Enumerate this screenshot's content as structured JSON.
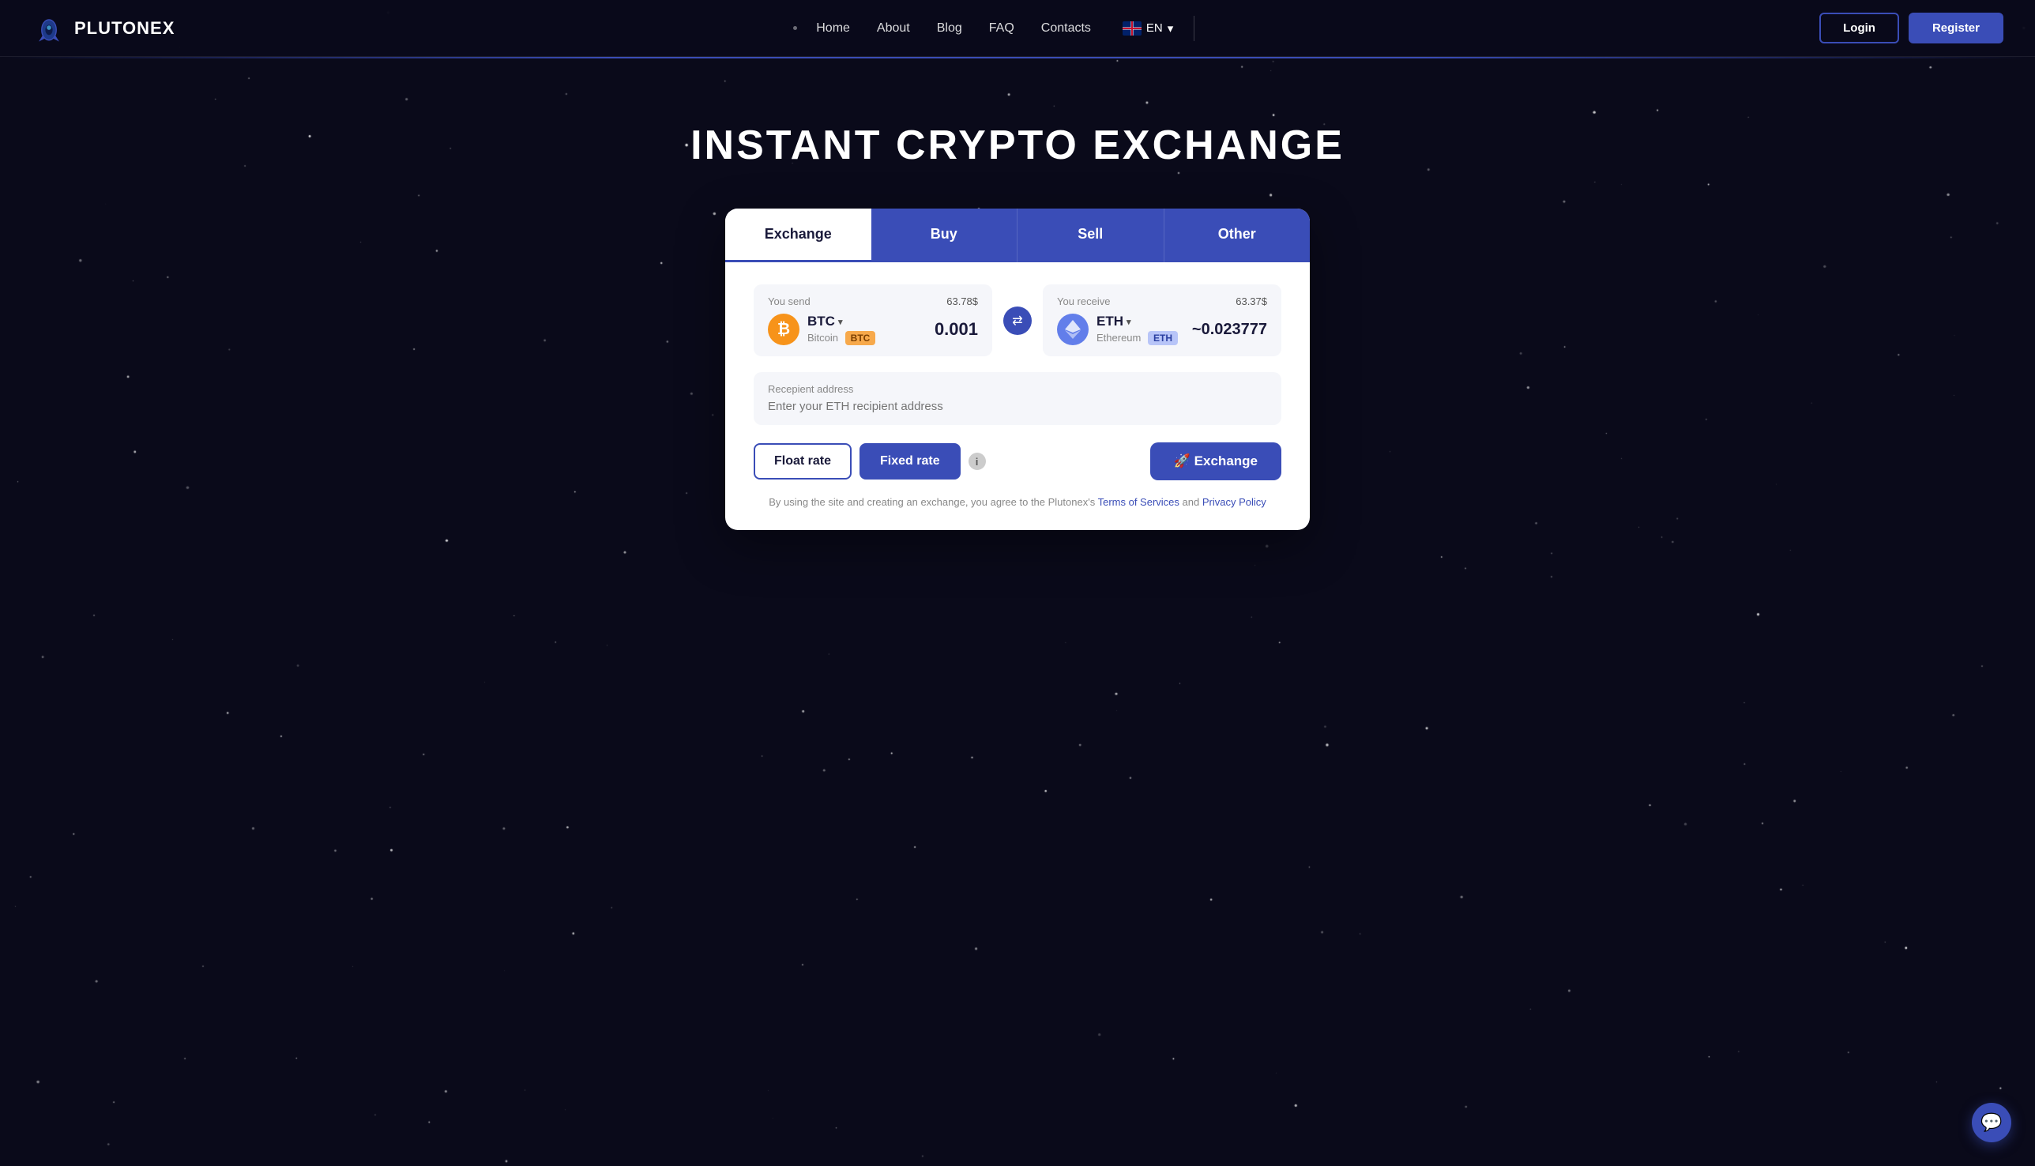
{
  "brand": {
    "name": "PLUTONEX",
    "logo_alt": "Plutonex rocket logo"
  },
  "navbar": {
    "nav_items": [
      {
        "label": "Home",
        "id": "home"
      },
      {
        "label": "About",
        "id": "about"
      },
      {
        "label": "Blog",
        "id": "blog"
      },
      {
        "label": "FAQ",
        "id": "faq"
      },
      {
        "label": "Contacts",
        "id": "contacts"
      }
    ],
    "language": "EN",
    "login_label": "Login",
    "register_label": "Register"
  },
  "hero": {
    "title": "INSTANT CRYPTO EXCHANGE"
  },
  "exchange_card": {
    "tabs": [
      {
        "label": "Exchange",
        "id": "exchange",
        "active": true
      },
      {
        "label": "Buy",
        "id": "buy"
      },
      {
        "label": "Sell",
        "id": "sell"
      },
      {
        "label": "Other",
        "id": "other"
      }
    ],
    "you_send": {
      "label": "You send",
      "amount_usd": "63.78$",
      "coin_ticker": "BTC",
      "coin_name": "Bitcoin",
      "coin_badge": "BTC",
      "amount": "0.001"
    },
    "you_receive": {
      "label": "You receive",
      "amount_usd": "63.37$",
      "coin_ticker": "ETH",
      "coin_name": "Ethereum",
      "coin_badge": "ETH",
      "amount": "~0.023777"
    },
    "recipient": {
      "label": "Recepient address",
      "placeholder": "Enter your ETH recipient address"
    },
    "float_rate_label": "Float rate",
    "fixed_rate_label": "Fixed rate",
    "exchange_btn_label": "🚀 Exchange",
    "terms_text": "By using the site and creating an exchange, you agree to the Plutonex's",
    "terms_link": "Terms of Services",
    "terms_and": "and",
    "privacy_link": "Privacy Policy"
  },
  "chat": {
    "icon": "💬"
  },
  "colors": {
    "brand_blue": "#3a4db7",
    "background": "#0a0a1a",
    "btc_orange": "#f7931a",
    "eth_blue": "#627eea"
  }
}
